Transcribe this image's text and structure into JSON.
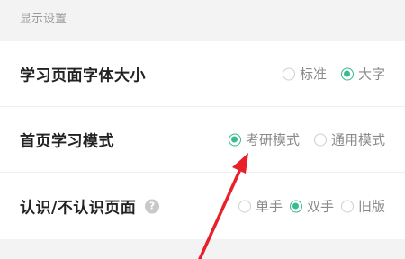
{
  "section": {
    "title": "显示设置"
  },
  "rows": {
    "font_size": {
      "label": "学习页面字体大小",
      "options": [
        {
          "label": "标准",
          "checked": false
        },
        {
          "label": "大字",
          "checked": true
        }
      ]
    },
    "home_mode": {
      "label": "首页学习模式",
      "options": [
        {
          "label": "考研模式",
          "checked": true
        },
        {
          "label": "通用模式",
          "checked": false
        }
      ]
    },
    "recognize_page": {
      "label": "认识/不认识页面",
      "help_icon": "question-mark",
      "help_glyph": "?",
      "options": [
        {
          "label": "单手",
          "checked": false
        },
        {
          "label": "双手",
          "checked": true
        },
        {
          "label": "旧版",
          "checked": false
        }
      ]
    }
  },
  "colors": {
    "accent": "#3aba8f",
    "annotation_arrow": "#e8202a",
    "section_bg": "#f3f3f3"
  }
}
